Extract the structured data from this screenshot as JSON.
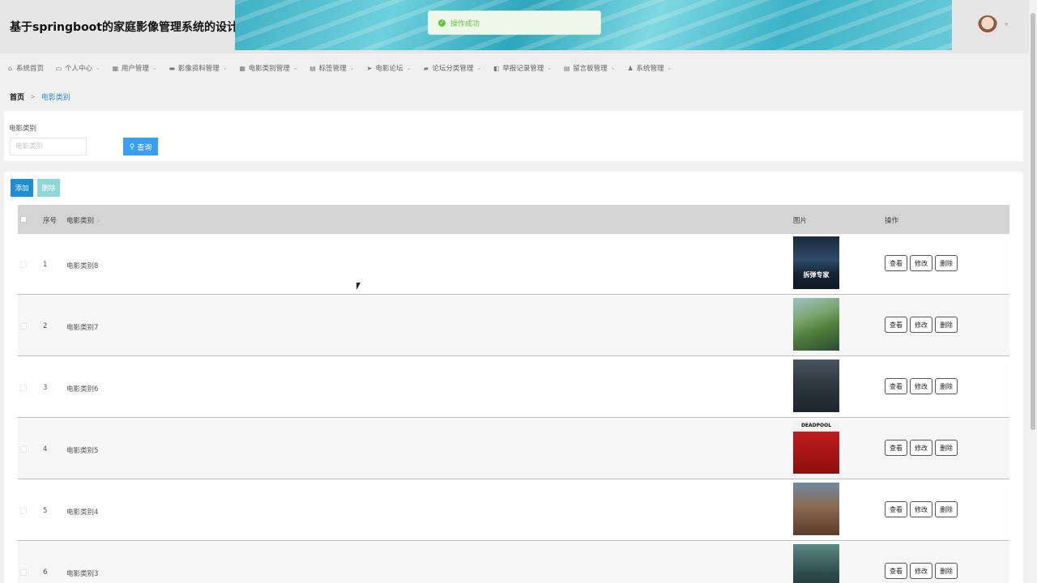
{
  "header": {
    "title": "基于springboot的家庭影像管理系统的设计与实现"
  },
  "toast": {
    "message": "操作成功"
  },
  "nav": {
    "items": [
      {
        "label": "系统首页",
        "icon": "home-icon",
        "has_caret": false
      },
      {
        "label": "个人中心",
        "icon": "calendar-icon",
        "has_caret": true
      },
      {
        "label": "用户管理",
        "icon": "grid-icon",
        "has_caret": true
      },
      {
        "label": "影像资料管理",
        "icon": "chat-icon",
        "has_caret": true
      },
      {
        "label": "电影类别管理",
        "icon": "grid-icon",
        "has_caret": true
      },
      {
        "label": "标签管理",
        "icon": "document-icon",
        "has_caret": true
      },
      {
        "label": "电影论坛",
        "icon": "send-icon",
        "has_caret": true
      },
      {
        "label": "论坛分类管理",
        "icon": "ticket-icon",
        "has_caret": true
      },
      {
        "label": "举报记录管理",
        "icon": "shop-icon",
        "has_caret": true
      },
      {
        "label": "留言板管理",
        "icon": "document-icon",
        "has_caret": true
      },
      {
        "label": "系统管理",
        "icon": "user-icon",
        "has_caret": true
      }
    ]
  },
  "breadcrumb": {
    "home": "首页",
    "separator": ">",
    "current": "电影类别"
  },
  "search": {
    "label": "电影类别",
    "placeholder": "电影类别",
    "button_label": "查询"
  },
  "toolbar": {
    "add_label": "添加",
    "delete_label": "删除"
  },
  "table": {
    "columns": {
      "index": "序号",
      "name": "电影类别",
      "image": "图片",
      "ops": "操作"
    },
    "op_labels": {
      "view": "查看",
      "edit": "修改",
      "delete": "删除"
    },
    "rows": [
      {
        "index": "1",
        "name": "电影类别8",
        "poster_caption": "拆弹专家"
      },
      {
        "index": "2",
        "name": "电影类别7",
        "poster_caption": ""
      },
      {
        "index": "3",
        "name": "电影类别6",
        "poster_caption": ""
      },
      {
        "index": "4",
        "name": "电影类别5",
        "poster_caption": "DEADPOOL"
      },
      {
        "index": "5",
        "name": "电影类别4",
        "poster_caption": ""
      },
      {
        "index": "6",
        "name": "电影类别3",
        "poster_caption": ""
      }
    ]
  },
  "colors": {
    "primary": "#1a8fd8",
    "search_button": "#3a9ef2",
    "delete_disabled": "#90d6d6",
    "success": "#67c23a",
    "breadcrumb_active": "#2b8fd8"
  }
}
